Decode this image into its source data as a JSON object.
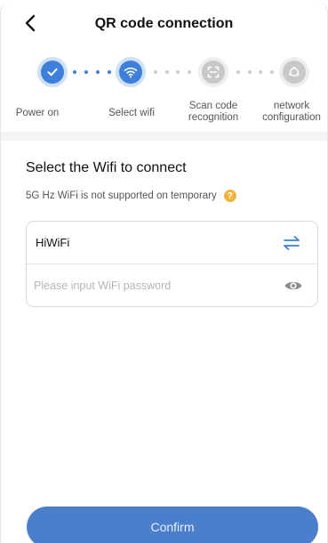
{
  "header": {
    "title": "QR code connection",
    "back_icon": "chevron-left-icon"
  },
  "steps": [
    {
      "label": "Power on",
      "icon": "check-icon",
      "state": "done"
    },
    {
      "label": "Select wifi",
      "icon": "wifi-icon",
      "state": "current"
    },
    {
      "label": "Scan code recognition",
      "icon": "scan-icon",
      "state": "pending"
    },
    {
      "label": "network configuration",
      "icon": "network-icon",
      "state": "pending"
    }
  ],
  "main": {
    "section_title": "Select the Wifi to connect",
    "notice": "5G Hz WiFi is not supported on temporary",
    "help_icon": "question-icon",
    "ssid": "HiWiFi",
    "password_value": "",
    "password_placeholder": "Please input WiFi password",
    "switch_icon": "swap-arrows-icon",
    "visibility_icon": "eye-icon"
  },
  "footer": {
    "confirm_label": "Confirm"
  },
  "colors": {
    "accent": "#3d7fd9",
    "button": "#4b7fcb",
    "warning": "#f0b43c",
    "inactive": "#c8c8c8"
  }
}
